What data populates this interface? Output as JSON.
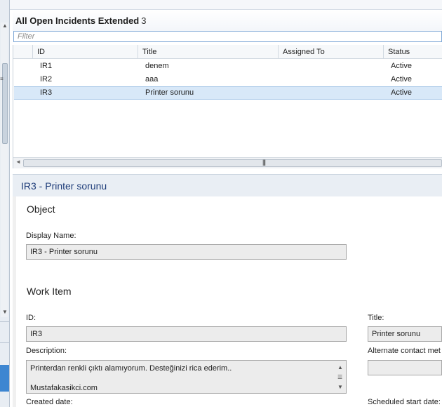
{
  "view": {
    "title": "All Open Incidents Extended",
    "count": "3",
    "filter_placeholder": "Filter"
  },
  "grid": {
    "columns": [
      "ID",
      "Title",
      "Assigned To",
      "Status"
    ],
    "rows": [
      {
        "id": "IR1",
        "title": "denem",
        "assigned_to": "",
        "status": "Active",
        "selected": false
      },
      {
        "id": "IR2",
        "title": "aaa",
        "assigned_to": "",
        "status": "Active",
        "selected": false
      },
      {
        "id": "IR3",
        "title": "Printer sorunu",
        "assigned_to": "",
        "status": "Active",
        "selected": true
      }
    ]
  },
  "details": {
    "header_title": "IR3 - Printer sorunu",
    "object_section": "Object",
    "display_name_label": "Display Name:",
    "display_name_value": "IR3 - Printer sorunu",
    "work_item_section": "Work Item",
    "id_label": "ID:",
    "id_value": "IR3",
    "title_label": "Title:",
    "title_value": "Printer sorunu",
    "description_label": "Description:",
    "description_line1": "Printerdan renkli çıktı alamıyorum. Desteğinizi rica ederim..",
    "description_line2": "Mustafakasikci.com",
    "alt_contact_label": "Alternate contact met",
    "alt_contact_value": "",
    "created_date_label": "Created date:",
    "scheduled_start_label": "Scheduled start date:"
  },
  "colors": {
    "selected_row": "#d8e8f8",
    "detail_title": "#1f3d7a",
    "nav_accent": "#3d86d1"
  }
}
